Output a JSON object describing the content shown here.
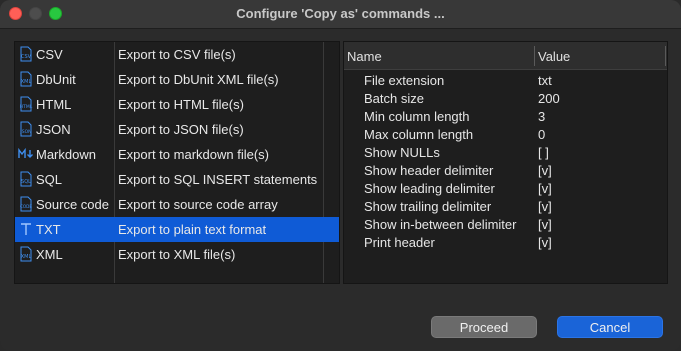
{
  "window": {
    "title": "Configure 'Copy as' commands ..."
  },
  "formats": [
    {
      "icon": "csv-file-icon",
      "name": "CSV",
      "description": "Export to CSV file(s)",
      "selected": false
    },
    {
      "icon": "dbunit-file-icon",
      "name": "DbUnit",
      "description": "Export to DbUnit XML file(s)",
      "selected": false
    },
    {
      "icon": "html-file-icon",
      "name": "HTML",
      "description": "Export to HTML file(s)",
      "selected": false
    },
    {
      "icon": "json-file-icon",
      "name": "JSON",
      "description": "Export to JSON file(s)",
      "selected": false
    },
    {
      "icon": "markdown-icon",
      "name": "Markdown",
      "description": "Export to markdown file(s)",
      "selected": false
    },
    {
      "icon": "sql-file-icon",
      "name": "SQL",
      "description": "Export to SQL INSERT statements",
      "selected": false
    },
    {
      "icon": "code-file-icon",
      "name": "Source code",
      "description": "Export to source code array",
      "selected": false
    },
    {
      "icon": "text-t-icon",
      "name": "TXT",
      "description": "Export to plain text format",
      "selected": true
    },
    {
      "icon": "xml-file-icon",
      "name": "XML",
      "description": "Export to XML file(s)",
      "selected": false
    }
  ],
  "properties": {
    "header_name": "Name",
    "header_value": "Value",
    "rows": [
      {
        "name": "File extension",
        "value": "txt"
      },
      {
        "name": "Batch size",
        "value": "200"
      },
      {
        "name": "Min column length",
        "value": "3"
      },
      {
        "name": "Max column length",
        "value": "0"
      },
      {
        "name": "Show NULLs",
        "value": "[ ]"
      },
      {
        "name": "Show header delimiter",
        "value": "[v]"
      },
      {
        "name": "Show leading delimiter",
        "value": "[v]"
      },
      {
        "name": "Show trailing delimiter",
        "value": "[v]"
      },
      {
        "name": "Show in-between delimiter",
        "value": "[v]"
      },
      {
        "name": "Print header",
        "value": "[v]"
      }
    ]
  },
  "buttons": {
    "proceed": "Proceed",
    "cancel": "Cancel"
  },
  "colors": {
    "selection": "#0f5bd6",
    "cancel_button": "#1a64d8",
    "icon_blue": "#3f8ff0"
  }
}
